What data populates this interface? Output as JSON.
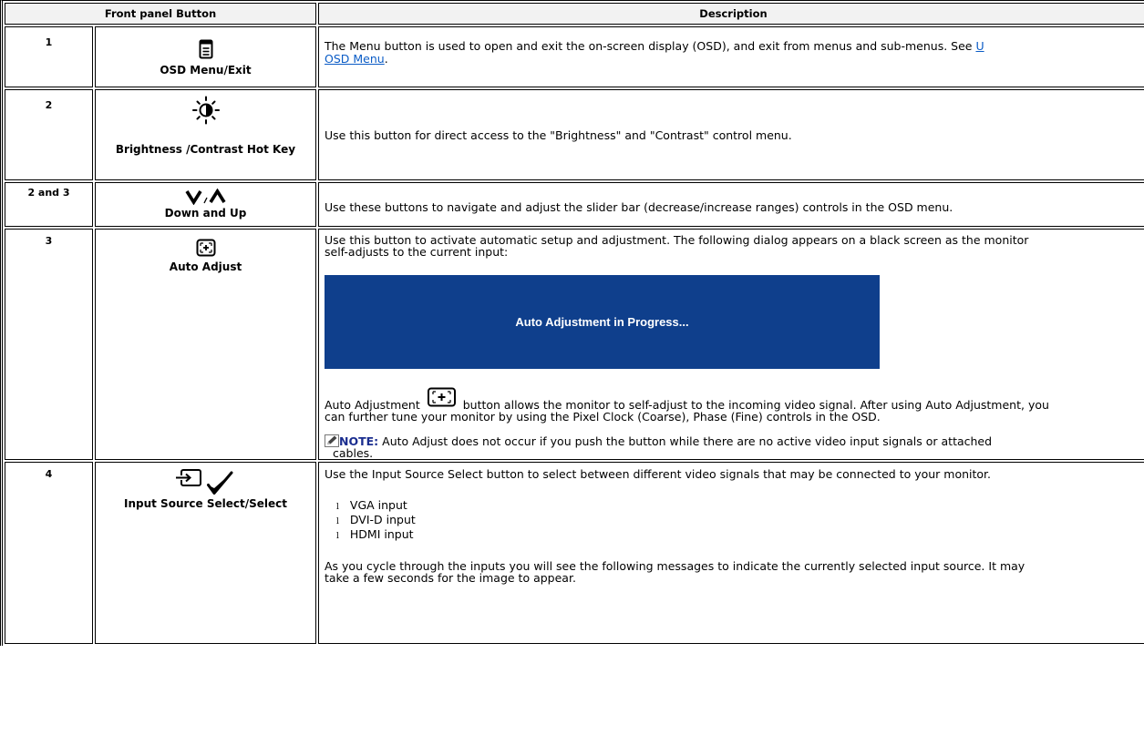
{
  "table": {
    "headers": [
      "Front panel Button",
      "Description"
    ],
    "rows": [
      {
        "num": "1",
        "icon": "osd-menu-icon",
        "button_label": "OSD Menu/Exit",
        "description": "The Menu button is used to open and exit the on-screen display (OSD), and exit from menus and sub-menus. See",
        "link_start": "U",
        "link_text": "OSD Menu",
        "link_end": "."
      },
      {
        "num": "2",
        "icon": "brightness-contrast-icon",
        "button_label": "Brightness /Contrast Hot Key",
        "description": "Use this button for direct access to the \"Brightness\" and \"Contrast\" control menu."
      },
      {
        "num": "2 and 3",
        "icon": "down-up-arrows-icon",
        "button_label": "Down and Up",
        "description": "Use these buttons to navigate and adjust the slider bar (decrease/increase ranges) controls in the OSD menu."
      },
      {
        "num": "3",
        "icon": "auto-adjust-icon",
        "button_label": "Auto Adjust",
        "description_line1": "Use this button to activate automatic setup and adjustment. The following dialog appears on a black screen as the monitor",
        "description_line2": "self-adjusts to the current input:",
        "banner_text": "Auto Adjustment in Progress...",
        "auto_para_pre": "Auto Adjustment",
        "auto_para_post": "button allows the monitor to self-adjust to the incoming video signal. After using Auto Adjustment, you",
        "auto_para_line2": "can further tune your monitor by using the Pixel Clock (Coarse), Phase (Fine) controls in the OSD.",
        "note_label": "NOTE:",
        "note_text": "Auto Adjust does not occur if you push the button while there are no active video input signals or attached",
        "note_line2": "cables."
      },
      {
        "num": "4",
        "icon": "input-source-select-icon",
        "button_label": "Input Source Select/Select",
        "description": "Use the Input Source Select button to select between different video signals that may be connected to your monitor.",
        "bullet_glyph": "l",
        "inputs": [
          "VGA input",
          "DVI-D input",
          "HDMI input"
        ],
        "cycle_line1": "As you cycle through the inputs you will see the following messages to indicate the currently selected input source. It may",
        "cycle_line2": "take a few seconds for the image to appear."
      }
    ]
  }
}
